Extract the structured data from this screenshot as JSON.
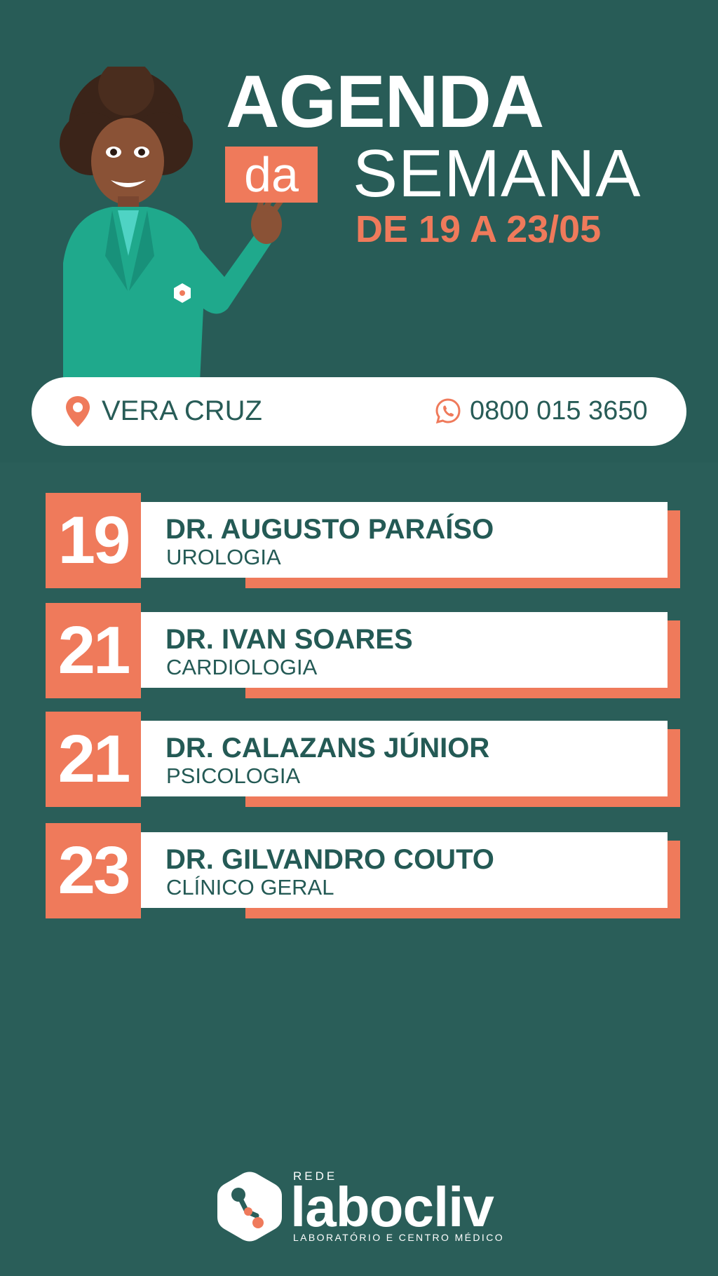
{
  "colors": {
    "background": "#2a5e59",
    "accent": "#ef7a5b",
    "text_dark": "#245a55",
    "white": "#ffffff"
  },
  "header": {
    "title_line1": "AGENDA",
    "title_da": "da",
    "title_line2": "SEMANA",
    "dates": "DE 19 A 23/05"
  },
  "info": {
    "location_icon": "map-pin-icon",
    "location": "VERA CRUZ",
    "phone_icon": "whatsapp-icon",
    "phone": "0800 015 3650"
  },
  "schedule": [
    {
      "day": "19",
      "doctor": "DR. AUGUSTO PARAÍSO",
      "specialty": "UROLOGIA"
    },
    {
      "day": "21",
      "doctor": "DR. IVAN SOARES",
      "specialty": "CARDIOLOGIA"
    },
    {
      "day": "21",
      "doctor": "DR. CALAZANS JÚNIOR",
      "specialty": "PSICOLOGIA"
    },
    {
      "day": "23",
      "doctor": "DR. GILVANDRO COUTO",
      "specialty": "CLÍNICO GERAL"
    }
  ],
  "logo": {
    "prefix": "REDE",
    "name": "labocliv",
    "tagline": "LABORATÓRIO E CENTRO MÉDICO"
  }
}
